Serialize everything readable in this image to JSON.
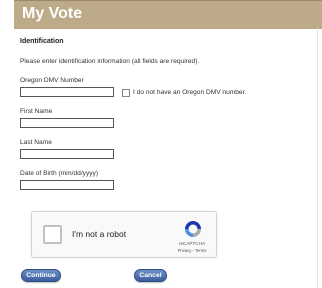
{
  "header": {
    "title": "My Vote"
  },
  "form": {
    "section_title": "Identification",
    "instructions": "Please enter identification information (all fields are required).",
    "dmv_label": "Oregon DMV Number",
    "dmv_value": "",
    "no_dmv_label": "I do not have an Oregon DMV number.",
    "no_dmv_checked": false,
    "first_name_label": "First Name",
    "first_name_value": "",
    "last_name_label": "Last Name",
    "last_name_value": "",
    "dob_label": "Date of Birth (mm/dd/yyyy)",
    "dob_value": ""
  },
  "recaptcha": {
    "label": "I'm not a robot",
    "brand": "reCAPTCHA",
    "terms": "Privacy - Terms",
    "logo_icon": "recaptcha-logo-icon",
    "logo_colors": {
      "blue": "#1c3aa9",
      "light_blue": "#4a90e2",
      "gray": "#ababab"
    }
  },
  "buttons": {
    "continue_label": "Continue",
    "cancel_label": "Cancel"
  },
  "colors": {
    "header_bg": "#bcaa88",
    "button_blue": "#3a5e9c"
  }
}
